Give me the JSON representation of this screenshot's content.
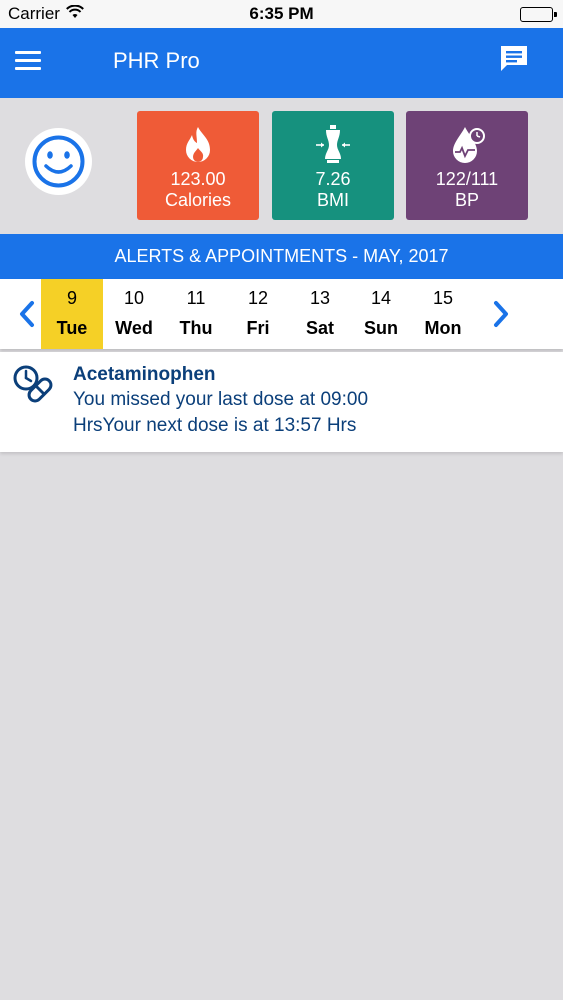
{
  "status_bar": {
    "carrier": "Carrier",
    "time": "6:35 PM"
  },
  "nav": {
    "title": "PHR Pro",
    "menu_icon": "hamburger-menu-icon",
    "chat_icon": "chat-icon"
  },
  "summary": {
    "avatar_icon": "smiley-face-icon",
    "tiles": [
      {
        "value": "123.00",
        "label": "Calories",
        "icon": "flame-icon",
        "color": "#ef5b37"
      },
      {
        "value": "7.26",
        "label": "BMI",
        "icon": "body-measure-icon",
        "color": "#16917e"
      },
      {
        "value": "122/111",
        "label": "BP",
        "icon": "blood-pressure-icon",
        "color": "#6e4276"
      }
    ]
  },
  "alerts": {
    "header": "ALERTS & APPOINTMENTS - MAY, 2017"
  },
  "calendar": {
    "days": [
      {
        "num": "9",
        "name": "Tue",
        "selected": true
      },
      {
        "num": "10",
        "name": "Wed"
      },
      {
        "num": "11",
        "name": "Thu"
      },
      {
        "num": "12",
        "name": "Fri"
      },
      {
        "num": "13",
        "name": "Sat"
      },
      {
        "num": "14",
        "name": "Sun"
      },
      {
        "num": "15",
        "name": "Mon"
      }
    ],
    "selected_color": "#f5d026"
  },
  "alert_items": [
    {
      "icon": "pill-clock-icon",
      "title": "Acetaminophen",
      "line1": "You missed your last dose at 09:00",
      "line2": "HrsYour next dose is at 13:57 Hrs"
    }
  ],
  "colors": {
    "accent": "#1a73e8",
    "text_dark": "#0b3f7a",
    "background": "#dedde0"
  }
}
